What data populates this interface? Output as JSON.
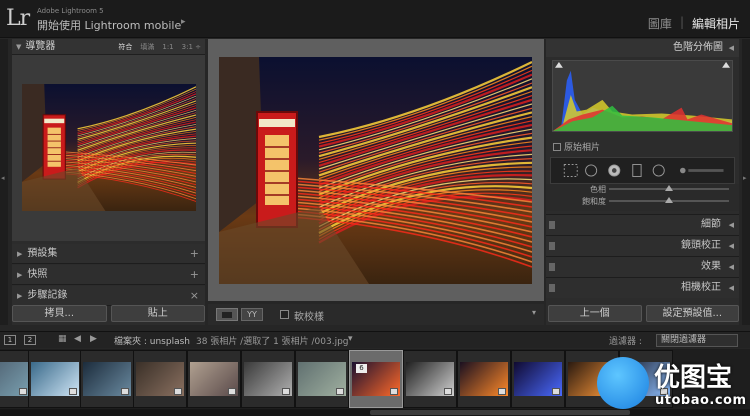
{
  "app": {
    "logo": "Lr",
    "name": "Adobe Lightroom 5",
    "subtitle": "開始使用 Lightroom mobile",
    "subtitle_arrow": "▸"
  },
  "modules": {
    "library": "圖庫",
    "separator": "|",
    "develop": "編輯相片"
  },
  "left_panel": {
    "navigator": {
      "title": "導覽器",
      "options": [
        "符合",
        "填滿",
        "1:1",
        "3:1 ÷"
      ]
    },
    "presets": "預設集",
    "snapshots": "快照",
    "history": "步驟記錄",
    "plus": "+",
    "close": "×",
    "copy_button": "拷貝...",
    "paste_button": "貼上"
  },
  "toolbar": {
    "yy": "YY",
    "soft_proof": "軟校樣",
    "menu_arrow": "▾"
  },
  "right_panel": {
    "histogram": "色階分佈圖",
    "original_photo": "原始相片",
    "basic_rows": [
      "色相",
      "飽和度"
    ],
    "sections": [
      "細節",
      "鏡頭校正",
      "效果",
      "相機校正"
    ],
    "previous_button": "上一個",
    "reset_button": "設定預設值..."
  },
  "filmstrip_bar": {
    "view1": "1",
    "view2": "2",
    "path": "檔案夾 : unsplash",
    "count": "38 張相片 /選取了 1 張相片 /003.jpg",
    "dropdown_arrow": "▾",
    "filter_label": "過濾器 :",
    "filter_value": "關閉過濾器"
  },
  "filmstrip": {
    "selected_number": "6"
  },
  "watermark": {
    "text": "优图宝",
    "url": "utobao.com"
  },
  "colors": {
    "accent_red": "#d81f1f",
    "panel_bg": "#2c2c2c",
    "center_bg": "#5f5f5f"
  }
}
